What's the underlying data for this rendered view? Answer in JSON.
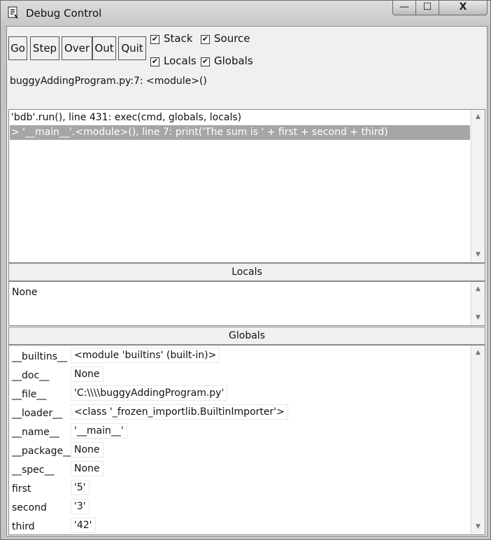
{
  "window": {
    "title": "Debug Control",
    "controls": {
      "minimize": "—",
      "maximize": "☐",
      "close": "X"
    }
  },
  "toolbar": {
    "go": "Go",
    "step": "Step",
    "over": "Over",
    "out": "Out",
    "quit": "Quit"
  },
  "checkboxes": {
    "stack": {
      "label": "Stack",
      "checked": true
    },
    "source": {
      "label": "Source",
      "checked": true
    },
    "locals": {
      "label": "Locals",
      "checked": true
    },
    "globals": {
      "label": "Globals",
      "checked": true
    },
    "mark": "✔"
  },
  "status": "buggyAddingProgram.py:7: <module>()",
  "stack": [
    "'bdb'.run(), line 431: exec(cmd, globals, locals)",
    "> '__main__'.<module>(), line 7: print('The sum is ' + first + second + third)"
  ],
  "locals": {
    "header": "Locals",
    "content": "None"
  },
  "globals": {
    "header": "Globals",
    "rows": [
      {
        "name": "__builtins__",
        "value": "<module 'builtins' (built-in)>"
      },
      {
        "name": "__doc__",
        "value": "None"
      },
      {
        "name": "__file__",
        "value": "'C:\\\\\\\\buggyAddingProgram.py'"
      },
      {
        "name": "__loader__",
        "value": "<class '_frozen_importlib.BuiltinImporter'>"
      },
      {
        "name": "__name__",
        "value": "'__main__'"
      },
      {
        "name": "__package__",
        "value": "None"
      },
      {
        "name": "__spec__",
        "value": "None"
      },
      {
        "name": "first",
        "value": "'5'"
      },
      {
        "name": "second",
        "value": "'3'"
      },
      {
        "name": "third",
        "value": "'42'"
      }
    ]
  },
  "scroll_arrows": {
    "up": "▲",
    "down": "▼"
  }
}
